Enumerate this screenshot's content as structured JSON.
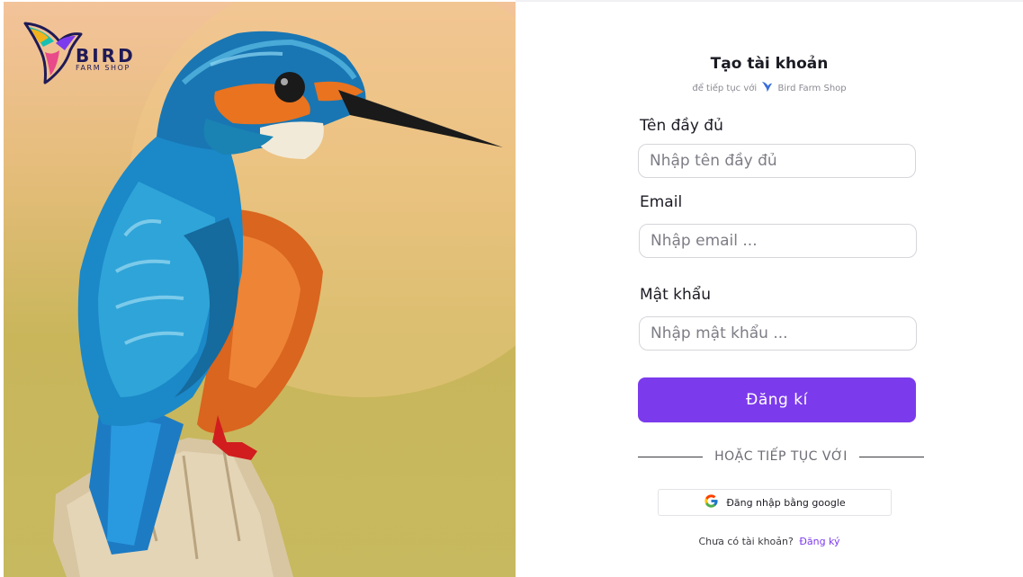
{
  "brand": {
    "name": "BIRD",
    "tagline": "FARM SHOP"
  },
  "hero": {
    "image": "kingfisher-bird-photo"
  },
  "form": {
    "title": "Tạo tài khoản",
    "subtitle_prefix": "để tiếp tục với",
    "subtitle_brand": "Bird Farm Shop",
    "fields": [
      {
        "label": "Tên đầy đủ",
        "placeholder": "Nhập tên đầy đủ",
        "value": ""
      },
      {
        "label": "Email",
        "placeholder": "Nhập email ...",
        "value": ""
      },
      {
        "label": "Mật khẩu",
        "placeholder": "Nhập mật khẩu ...",
        "value": ""
      }
    ],
    "submit_label": "Đăng kí",
    "divider_text": "HOẶC TIẾP TỤC VỚI",
    "google_label": "Đăng nhập bằng google",
    "signin_prompt": "Chưa có tài khoản?",
    "signin_link": "Đăng ký"
  },
  "colors": {
    "accent": "#7c3aed",
    "brand_navy": "#1f1a56",
    "input_border": "#d6d6db"
  }
}
